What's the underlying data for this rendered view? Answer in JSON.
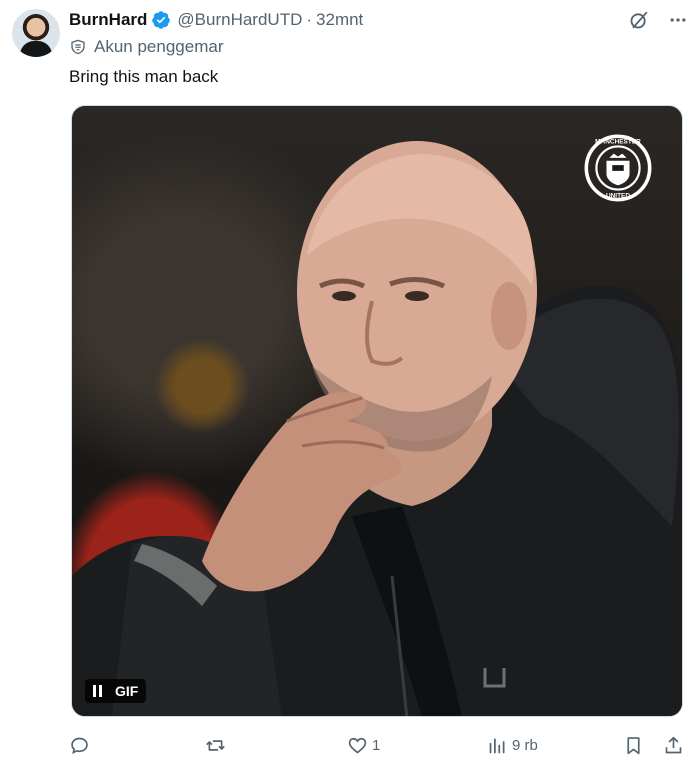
{
  "author": {
    "name": "BurnHard",
    "handle": "@BurnHardUTD",
    "separator": "·",
    "time": "32mnt",
    "badge_color": "#1d9bf0"
  },
  "label": {
    "text": "Akun penggemar"
  },
  "tweet": {
    "text": "Bring this man back"
  },
  "media": {
    "type_label": "GIF",
    "crest_top_text": "MANCHESTER",
    "crest_bottom_text": "UNITED"
  },
  "actions": {
    "reply_count": "",
    "repost_count": "",
    "like_count": "1",
    "views_count": "9 rb"
  },
  "icons": [
    "verified-icon",
    "grok-icon",
    "more-icon",
    "shield-icon",
    "pause-icon",
    "reply-icon",
    "repost-icon",
    "like-icon",
    "views-icon",
    "bookmark-icon",
    "share-icon"
  ]
}
